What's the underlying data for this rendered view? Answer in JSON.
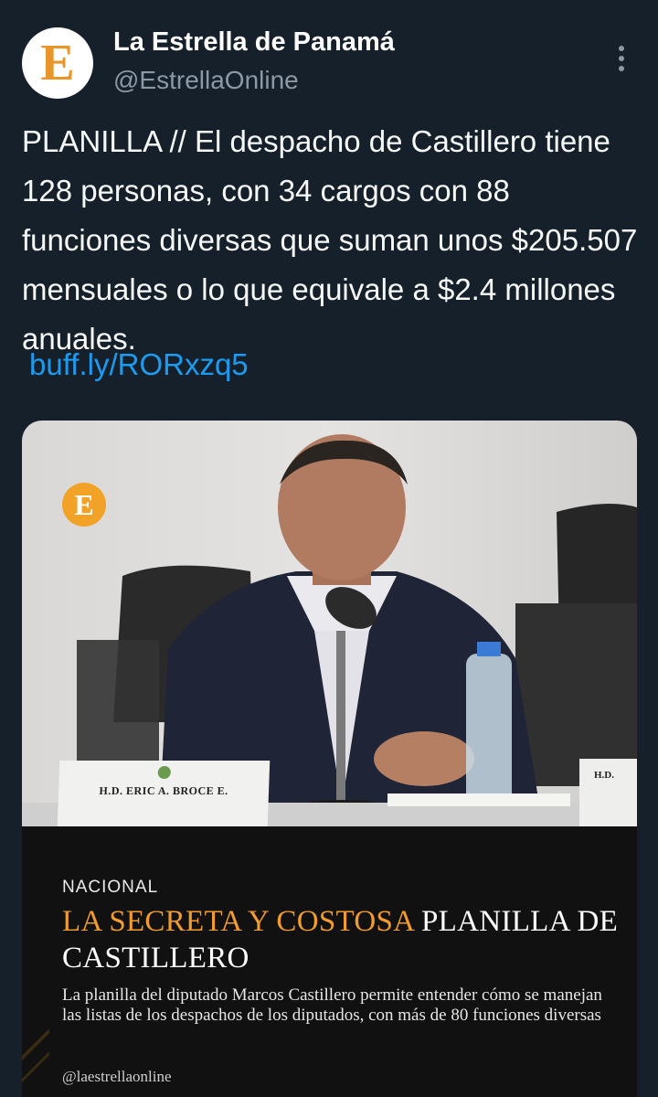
{
  "account": {
    "name": "La Estrella de Panamá",
    "handle": "@EstrellaOnline",
    "avatar_letter": "E",
    "accent_color": "#e8962a"
  },
  "tweet": {
    "text": "PLANILLA // El despacho de Castillero tiene 128 personas, con 34 cargos con 88 funciones diversas que suman unos $205.507 mensuales o lo que equivale a $2.4 millones anuales.",
    "link": "buff.ly/RORxzq5",
    "link_color": "#1d9bf0"
  },
  "media": {
    "badge_letter": "E",
    "nameplate_name": "H.D. ERIC A. BROCE E.",
    "nameplate_right": "H.D.",
    "section": "NACIONAL",
    "headline_accent": "LA SECRETA Y COSTOSA",
    "headline_rest": "PLANILLA DE CASTILLERO",
    "summary": "La planilla del diputado Marcos Castillero permite entender cómo se manejan las listas de los despachos de los diputados, con más de 80 funciones diversas",
    "credit": "@laestrellaonline"
  },
  "icons": {
    "more": "more-vertical-icon"
  }
}
